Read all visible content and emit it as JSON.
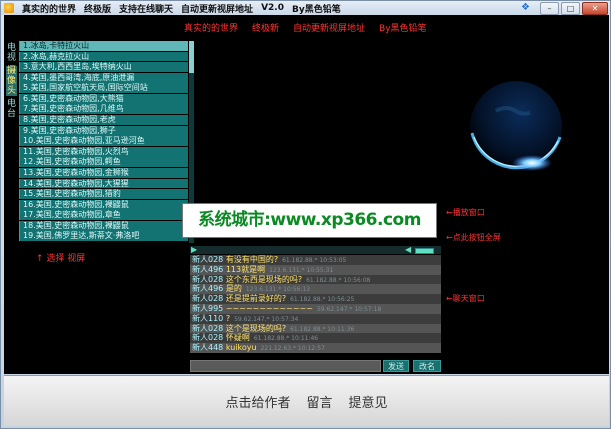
{
  "menu": {
    "items": [
      "真实的的世界",
      "终极版",
      "支持在线聊天",
      "自动更新视屏地址",
      "V2.0",
      "By黑色铅笔"
    ]
  },
  "window_controls": {
    "minimize": "–",
    "maximize": "□",
    "close": "✕",
    "help": "❖"
  },
  "top_links": [
    "真实的的世界",
    "终极新",
    "自动更新视屏地址",
    "By黑色铅笔"
  ],
  "side_tabs": [
    {
      "label": "电视",
      "active": false
    },
    {
      "label": "摄像头",
      "active": true
    },
    {
      "label": "电台",
      "active": false
    }
  ],
  "channels": [
    {
      "label": "1.冰岛,卡特拉火山",
      "selected": true
    },
    {
      "label": "2.冰岛,赫克拉火山",
      "selected": false
    },
    {
      "label": "3.意大利,西西里岛,埃特纳火山",
      "selected": false
    },
    {
      "label": "4.美国,墨西哥湾,海底,原油泄漏",
      "selected": false
    },
    {
      "label": "5.美国,国家航空航天局,国际空间站",
      "selected": false
    },
    {
      "label": "6.美国,史密森动物园,大熊猫",
      "selected": false
    },
    {
      "label": "7.美国,史密森动物园,几维鸟",
      "selected": false
    },
    {
      "label": "8.美国,史密森动物园,老虎",
      "selected": false
    },
    {
      "label": "9.美国,史密森动物园,狮子",
      "selected": false
    },
    {
      "label": "10.美国,史密森动物园,亚马逊河鱼",
      "selected": false
    },
    {
      "label": "11.美国,史密森动物园,火烈鸟",
      "selected": false
    },
    {
      "label": "12.美国,史密森动物园,鳄鱼",
      "selected": false
    },
    {
      "label": "13.美国,史密森动物园,金狮猴",
      "selected": false
    },
    {
      "label": "14.美国,史密森动物园,大猩猩",
      "selected": false
    },
    {
      "label": "15.美国,史密森动物园,猎豹",
      "selected": false
    },
    {
      "label": "16.美国,史密森动物园,裸鼹鼠",
      "selected": false
    },
    {
      "label": "17.美国,史密森动物园,章鱼",
      "selected": false
    },
    {
      "label": "18.美国,史密森动物园,裸鼹鼠",
      "selected": false
    },
    {
      "label": "19.美国,佛罗里达,斯蒂文·弗洛吧",
      "selected": false
    }
  ],
  "select_hint": "↑  选择 视屏",
  "watermark": "系统城市:www.xp366.com",
  "annotations": {
    "monitor": "←播放窗口",
    "fullscreen": "←点此按钮全屏",
    "chat": "←聊天窗口"
  },
  "chat": {
    "messages": [
      {
        "nick": "新人028",
        "text": "有没有中国的?",
        "ip": "61.182.88.* 10:53:05"
      },
      {
        "nick": "新人496",
        "text": "113就是啊",
        "ip": "123.6.131.* 10:55:31"
      },
      {
        "nick": "新人028",
        "text": "这个东西是现场的吗?",
        "ip": "61.182.88.* 10:56:08"
      },
      {
        "nick": "新人496",
        "text": "是的",
        "ip": "123.6.131.* 10:56:13"
      },
      {
        "nick": "新人028",
        "text": "还是提前录好的?",
        "ip": "61.182.88.* 10:56:25"
      },
      {
        "nick": "新人995",
        "text": "~~~~~~~~~~~~~",
        "ip": "59.62.147.* 10:57:18"
      },
      {
        "nick": "新人110",
        "text": "?",
        "ip": "59.62.147.* 10:57:34"
      },
      {
        "nick": "新人028",
        "text": "这个是现场的吗?",
        "ip": "61.182.88.* 10:11:36"
      },
      {
        "nick": "新人028",
        "text": "怀疑啊",
        "ip": "61.182.88.* 10:11:46"
      },
      {
        "nick": "新人448",
        "text": "kuikoyu",
        "ip": "221.12.63.* 10:12:57"
      }
    ],
    "input_value": "",
    "send_label": "发送",
    "nick_label": "改名"
  },
  "bottom_links": [
    "点击给作者",
    "留言",
    "提意见"
  ],
  "colors": {
    "accent_red": "#ff3333",
    "channel_bg": "#137373",
    "watermark_green": "#0a8a22"
  }
}
